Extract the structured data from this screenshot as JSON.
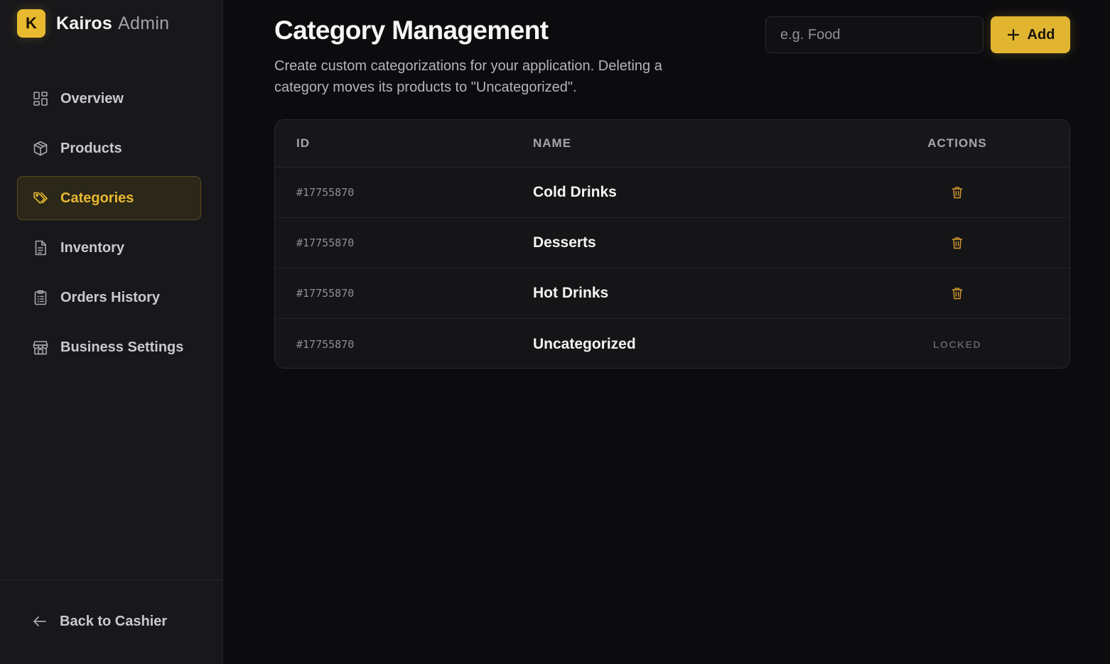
{
  "brand": {
    "badge": "K",
    "name": "Kairos",
    "sub": "Admin"
  },
  "sidebar": {
    "items": [
      {
        "label": "Overview",
        "icon": "grid-icon"
      },
      {
        "label": "Products",
        "icon": "box-icon"
      },
      {
        "label": "Categories",
        "icon": "tags-icon",
        "active": true
      },
      {
        "label": "Inventory",
        "icon": "document-icon"
      },
      {
        "label": "Orders History",
        "icon": "clipboard-icon"
      },
      {
        "label": "Business Settings",
        "icon": "store-icon"
      }
    ],
    "back_label": "Back to Cashier"
  },
  "page": {
    "title": "Category Management",
    "description": "Create custom categorizations for your application. Deleting a category moves its products to \"Uncategorized\"."
  },
  "add_form": {
    "placeholder": "e.g. Food",
    "value": "",
    "button_label": "Add"
  },
  "table": {
    "headers": {
      "id": "ID",
      "name": "NAME",
      "actions": "ACTIONS"
    },
    "rows": [
      {
        "id": "#17755870",
        "name": "Cold Drinks",
        "action": "delete"
      },
      {
        "id": "#17755870",
        "name": "Desserts",
        "action": "delete"
      },
      {
        "id": "#17755870",
        "name": "Hot Drinks",
        "action": "delete"
      },
      {
        "id": "#17755870",
        "name": "Uncategorized",
        "action": "locked",
        "action_label": "LOCKED"
      }
    ]
  },
  "colors": {
    "accent": "#e2b531",
    "background": "#0c0c0f",
    "sidebar": "#18181b",
    "delete_icon": "#d59a2c"
  }
}
